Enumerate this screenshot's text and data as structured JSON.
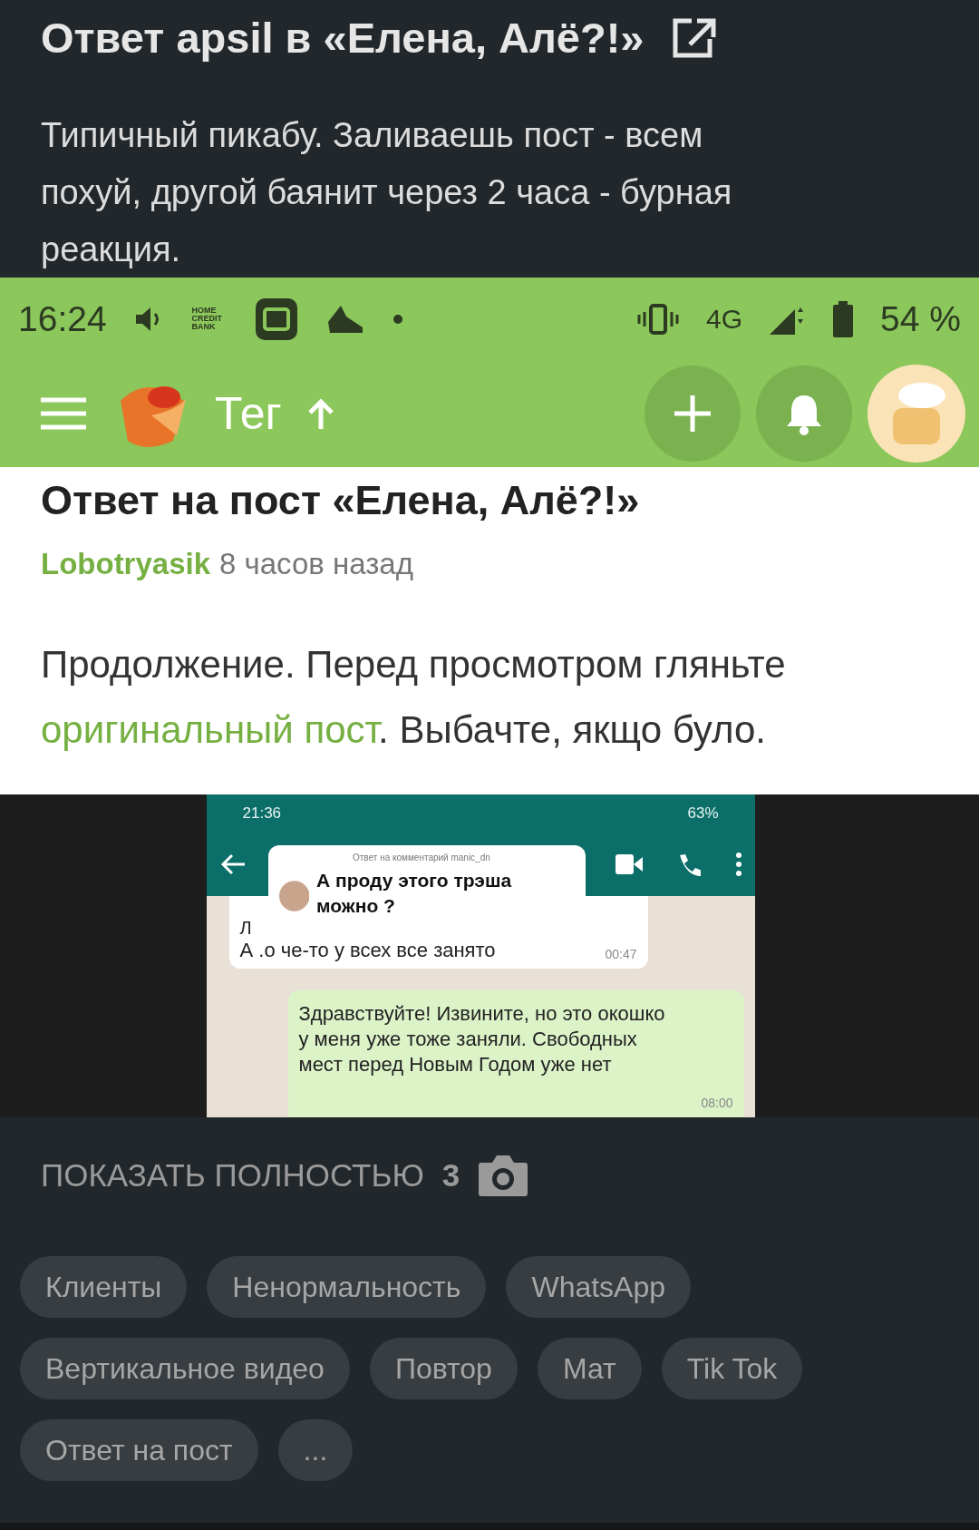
{
  "comment": {
    "title": "Ответ apsil в «Елена, Алё?!»",
    "text": "Типичный пикабу. Заливаешь пост - всем похуй, другой баянит через 2 часа - бурная реакция."
  },
  "screenshot": {
    "status_bar": {
      "time": "16:24",
      "bank_badge": "HOME CREDIT BANK",
      "network": "4G",
      "battery": "54 %"
    },
    "app_bar": {
      "title": "Тег"
    },
    "post": {
      "title": "Ответ на пост «Елена, Алё?!»",
      "author": "Lobotryasik",
      "time": "8 часов назад",
      "text_before": "Продолжение. Перед просмотром гляньте",
      "link": "оригинальный пост",
      "text_after": ". Выбачте, якщо було."
    },
    "image": {
      "status_time": "21:36",
      "status_battery": "63%",
      "popup_header": "Ответ на комментарий manic_dn",
      "popup_text": "А проду этого трэша можно ?",
      "incoming_name": "Л",
      "incoming_text": "А .о че-то у всех все занято",
      "incoming_time": "00:47",
      "outgoing_text": "Здравствуйте! Извините, но это окошко у меня уже тоже заняли. Свободных мест перед Новым Годом уже нет",
      "outgoing_time": "08:00"
    }
  },
  "footer": {
    "show_full": "ПОКАЗАТЬ ПОЛНОСТЬЮ",
    "photo_count": "3",
    "tags": [
      "Клиенты",
      "Ненормальность",
      "WhatsApp",
      "Вертикальное видео",
      "Повтор",
      "Мат",
      "Tik Tok",
      "Ответ на пост",
      "..."
    ]
  }
}
